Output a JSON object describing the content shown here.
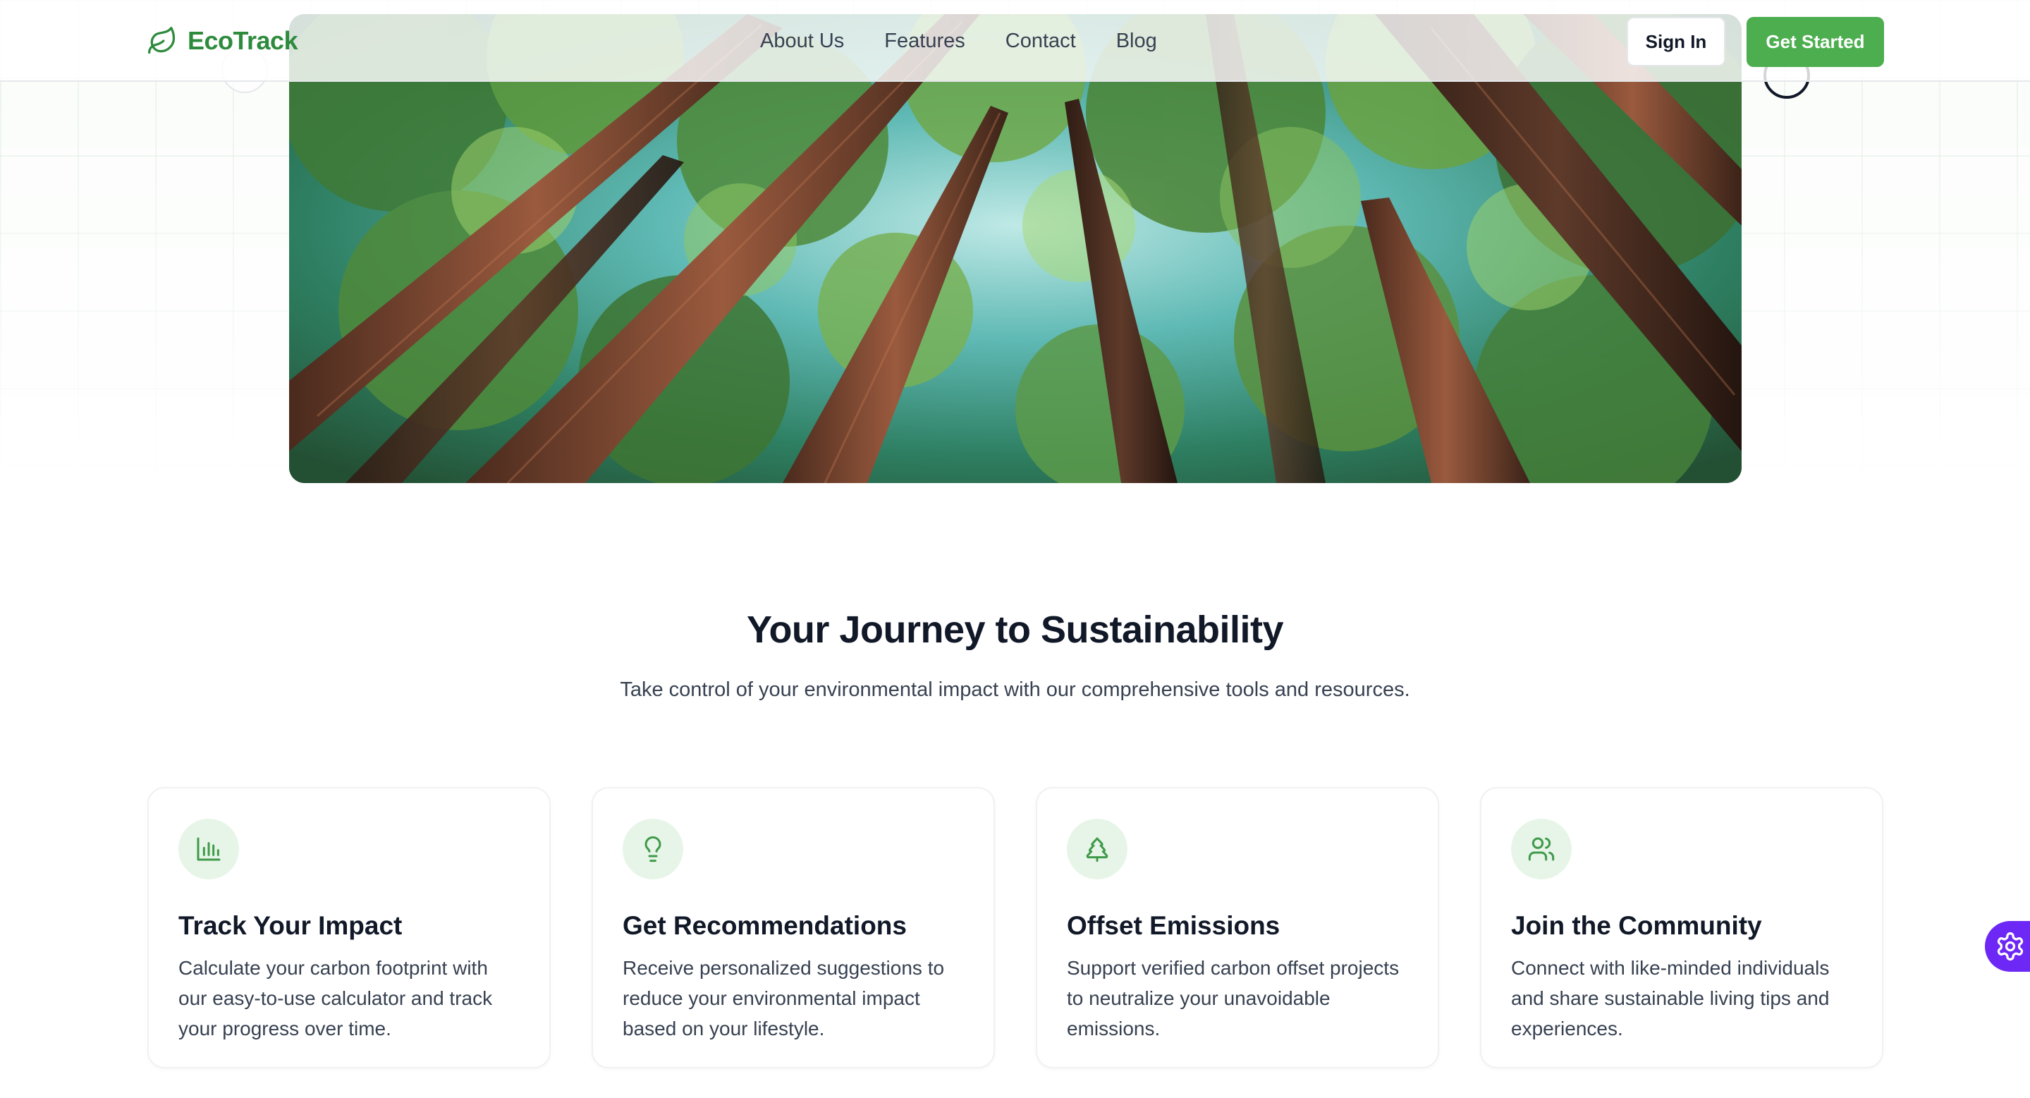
{
  "brand": {
    "name": "EcoTrack",
    "color": "#2e8b3d",
    "icon": "leaf-icon"
  },
  "nav": {
    "items": [
      {
        "label": "About Us"
      },
      {
        "label": "Features"
      },
      {
        "label": "Contact"
      },
      {
        "label": "Blog"
      }
    ]
  },
  "auth": {
    "sign_in_label": "Sign In",
    "get_started_label": "Get Started",
    "accent": "#4cae4f"
  },
  "hero": {
    "image": "forest-canopy-photo"
  },
  "section": {
    "title": "Your Journey to Sustainability",
    "subtitle": "Take control of your environmental impact with our comprehensive tools and resources."
  },
  "features": [
    {
      "icon": "bar-chart-icon",
      "title": "Track Your Impact",
      "description": "Calculate your carbon footprint with our easy-to-use calculator and track your progress over time."
    },
    {
      "icon": "lightbulb-icon",
      "title": "Get Recommendations",
      "description": "Receive personalized suggestions to reduce your environmental impact based on your lifestyle."
    },
    {
      "icon": "tree-icon",
      "title": "Offset Emissions",
      "description": "Support verified carbon offset projects to neutralize your unavoidable emissions."
    },
    {
      "icon": "users-icon",
      "title": "Join the Community",
      "description": "Connect with like-minded individuals and share sustainable living tips and experiences."
    }
  ],
  "widget": {
    "icon": "settings-gear-icon",
    "color": "#6d28f5"
  }
}
